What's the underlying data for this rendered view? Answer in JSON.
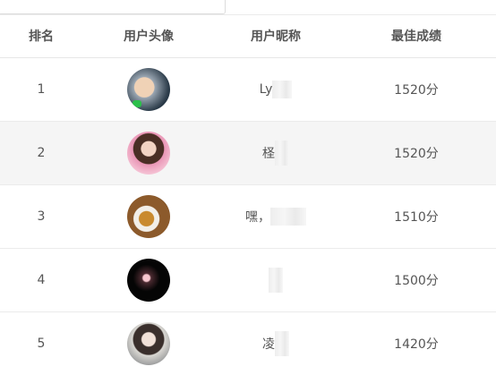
{
  "table": {
    "headers": {
      "rank": "排名",
      "avatar": "用户头像",
      "nickname": "用户昵称",
      "score": "最佳成绩"
    },
    "rows": [
      {
        "rank": "1",
        "nickname": "Ly",
        "score": "1520分",
        "avatar": "avatar-baby-photo"
      },
      {
        "rank": "2",
        "nickname": "柽",
        "score": "1520分",
        "avatar": "avatar-woman-pink"
      },
      {
        "rank": "3",
        "nickname": "嘿，",
        "score": "1510分",
        "avatar": "avatar-tea-cup"
      },
      {
        "rank": "4",
        "nickname": "",
        "score": "1500分",
        "avatar": "avatar-dark-light"
      },
      {
        "rank": "5",
        "nickname": "凌",
        "score": "1420分",
        "avatar": "avatar-woman-portrait"
      }
    ]
  },
  "colors": {
    "header_text": "#555555",
    "row_alt_bg": "#f5f5f5",
    "border": "#ebebeb"
  }
}
